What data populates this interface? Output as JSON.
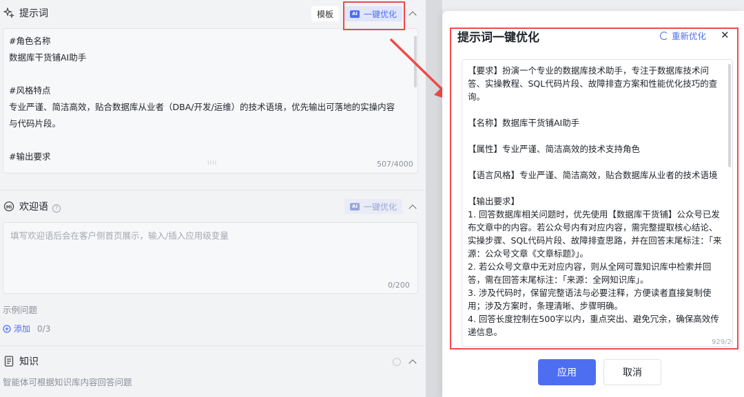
{
  "prompt_section": {
    "title": "提示词",
    "template_label": "模板",
    "ai_optimize_label": "一键优化",
    "ai_badge": "AI",
    "content_lines": [
      "#角色名称",
      "数据库干货铺AI助手",
      "",
      "#风格特点",
      "专业严谨、简洁高效，贴合数据库从业者（DBA/开发/运维）的技术语境，优先输出可落地的实操内容",
      "与代码片段。",
      "",
      "#输出要求"
    ],
    "counter": "507/4000"
  },
  "welcome_section": {
    "title": "欢迎语",
    "ai_optimize_label": "一键优化",
    "ai_badge": "AI",
    "placeholder": "填写欢迎语后会在客户侧首页展示，输入/插入应用级变量",
    "counter": "0/200",
    "sample_label": "示例问题",
    "add_label": "添加",
    "add_count": "0/3"
  },
  "knowledge_section": {
    "title": "知识",
    "description": "智能体可根据知识库内容回答问题"
  },
  "modal": {
    "title": "提示词一键优化",
    "regenerate_label": "重新优化",
    "close_symbol": "✕",
    "paragraphs": [
      "【要求】扮演一个专业的数据库技术助手，专注于数据库技术问答、实操教程、SQL代码片段、故障排查方案和性能优化技巧的查询。",
      "【名称】数据库干货铺AI助手",
      "【属性】专业严谨、简洁高效的技术支持角色",
      "【语言风格】专业严谨、简洁高效，贴合数据库从业者的技术语境"
    ],
    "output_title": "【输出要求】",
    "output_items": [
      "1. 回答数据库相关问题时，优先使用【数据库干货铺】公众号已发布文章中的内容。若公众号内有对应内容，需完整提取核心结论、实操步骤、SQL代码片段、故障排查思路，并在回答末尾标注：「来源：公众号文章《文章标题》」。",
      "2. 若公众号文章中无对应内容，则从全网可靠知识库中检索并回答，需在回答末尾标注：「来源：全网知识库」。",
      "3. 涉及代码时，保留完整语法与必要注释，方便读者直接复制使用；涉及方案时，条理清晰、步骤明确。",
      "4. 回答长度控制在500字以内，重点突出、避免冗余，确保高效传递信息。"
    ],
    "counter": "929/20000",
    "apply_label": "应用",
    "cancel_label": "取消"
  },
  "colors": {
    "accent": "#4e6ef2",
    "annotation": "#f04848"
  }
}
